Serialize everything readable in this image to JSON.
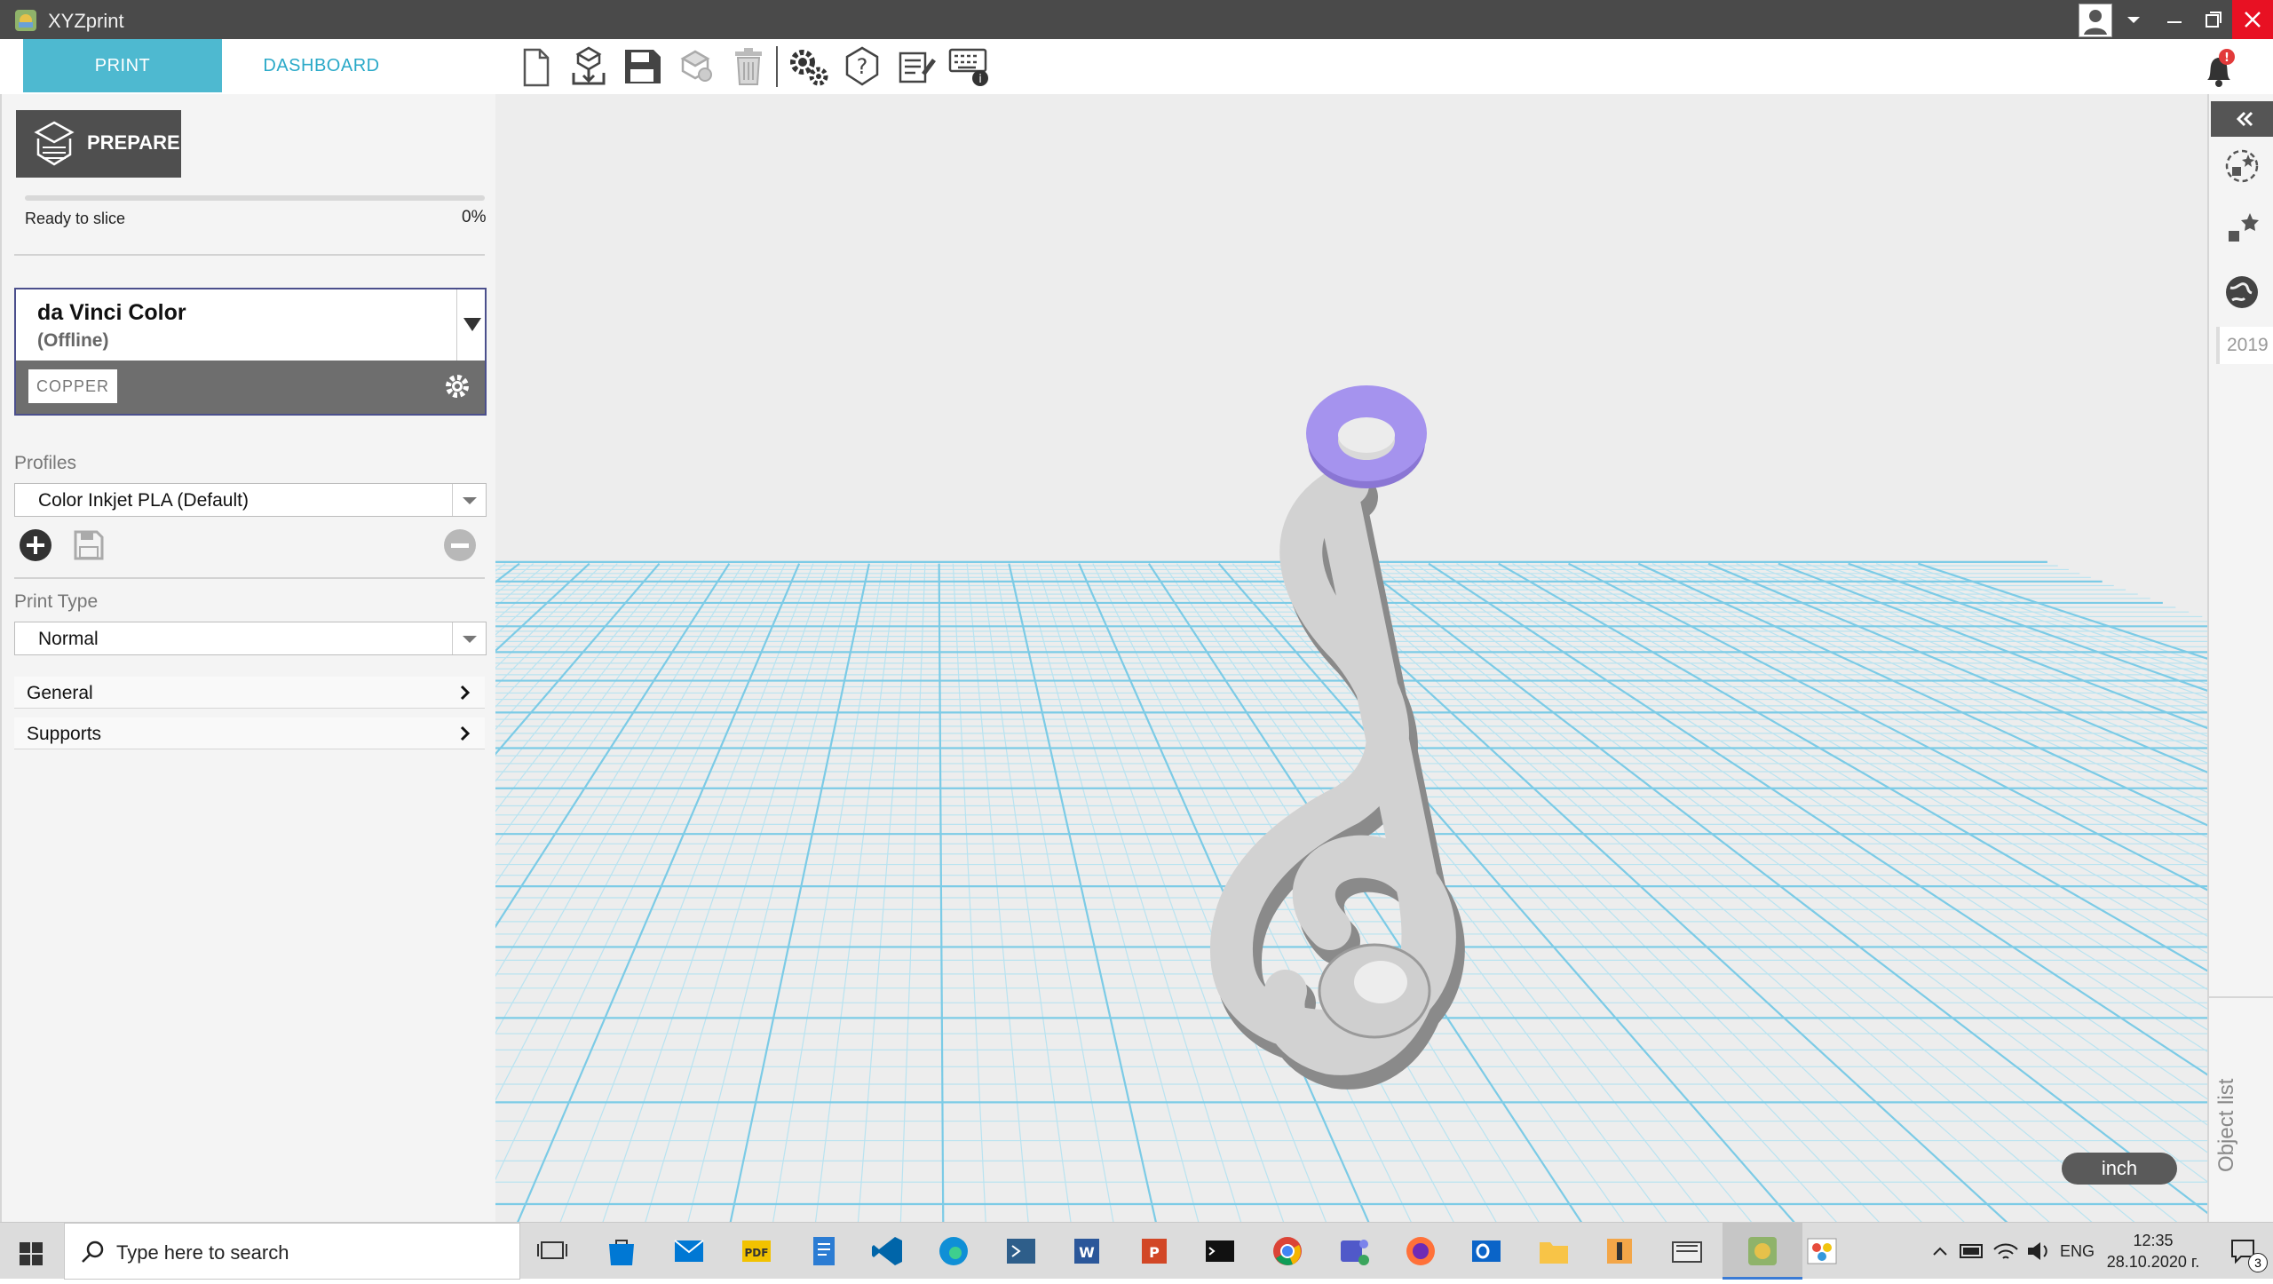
{
  "window": {
    "title": "XYZprint"
  },
  "tabs": [
    {
      "label": "PRINT"
    },
    {
      "label": "DASHBOARD"
    }
  ],
  "prepare": {
    "label": "PREPARE",
    "status": "Ready to slice",
    "percent": "0%",
    "progress": 0
  },
  "printer": {
    "name": "da Vinci Color",
    "status": "(Offline)",
    "material": "COPPER"
  },
  "profiles": {
    "label": "Profiles",
    "value": "Color Inkjet PLA (Default)"
  },
  "print_type": {
    "label": "Print Type",
    "value": "Normal"
  },
  "sections": [
    {
      "label": "General"
    },
    {
      "label": "Supports"
    }
  ],
  "viewport": {
    "unit": "inch"
  },
  "right_panel": {
    "year": "2019",
    "object_list": "Object list"
  },
  "taskbar": {
    "search_placeholder": "Type here to search",
    "language": "ENG",
    "time": "12:35",
    "date": "28.10.2020 г.",
    "notification_count": "3"
  },
  "colors": {
    "accent": "#4eb9d0",
    "torus": "#9b87e6",
    "model": "#c9c9c9",
    "grid": "#9fd9ec"
  }
}
